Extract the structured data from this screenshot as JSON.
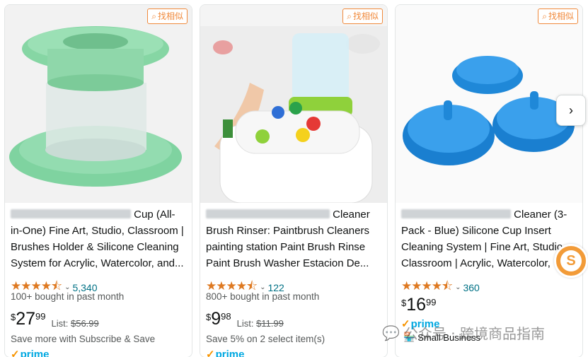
{
  "find_similar_label": "找相似",
  "products": [
    {
      "title_tail_line1": "Cup (All-",
      "title_rest": "in-One) Fine Art, Studio, Classroom | Brushes Holder & Silicone Cleaning System for Acrylic, Watercolor, and...",
      "rating_count": "5,340",
      "bought": "100+ bought in past month",
      "currency": "$",
      "price_whole": "27",
      "price_frac": "99",
      "list_label": "List:",
      "list_price": "$56.99",
      "save": "Save more with Subscribe & Save",
      "prime": "prime",
      "rating": 4.5
    },
    {
      "title_tail_line1": "Cleaner",
      "title_rest": "Brush Rinser: Paintbrush Cleaners painting station Paint Brush Rinse Paint Brush Washer Estacion De...",
      "rating_count": "122",
      "bought": "800+ bought in past month",
      "currency": "$",
      "price_whole": "9",
      "price_frac": "98",
      "list_label": "List:",
      "list_price": "$11.99",
      "save": "Save 5% on 2 select item(s)",
      "prime": "prime",
      "rating": 4.5
    },
    {
      "title_tail_line1": "Cleaner (3-",
      "title_rest": "Pack - Blue) Silicone Cup Insert Cleaning System | Fine Art, Studio Classroom | Acrylic, Watercolor,",
      "rating_count": "360",
      "bought": "",
      "currency": "$",
      "price_whole": "16",
      "price_frac": "99",
      "prime": "prime",
      "small_business": "Small Business",
      "rating": 4.5
    }
  ],
  "watermark": "公众号 · 跨境商品指南",
  "colors": {
    "accent": "#f08a3c",
    "star": "#de7921",
    "link": "#007185",
    "prime": "#00a8e1"
  },
  "icons": {
    "next": "chevron-right-icon",
    "float": "s-logo-icon"
  }
}
